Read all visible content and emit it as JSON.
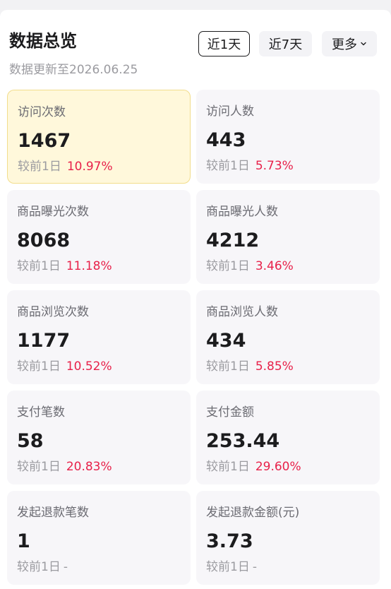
{
  "header": {
    "title": "数据总览",
    "subtitle": "数据更新至2026.06.25"
  },
  "range_tabs": [
    {
      "label": "近1天",
      "active": true
    },
    {
      "label": "近7天",
      "active": false
    }
  ],
  "more_label": "更多",
  "compare_label": "较前1日",
  "metrics": [
    {
      "label": "访问次数",
      "value": "1467",
      "change": "10.97%"
    },
    {
      "label": "访问人数",
      "value": "443",
      "change": "5.73%"
    },
    {
      "label": "商品曝光次数",
      "value": "8068",
      "change": "11.18%"
    },
    {
      "label": "商品曝光人数",
      "value": "4212",
      "change": "3.46%"
    },
    {
      "label": "商品浏览次数",
      "value": "1177",
      "change": "10.52%"
    },
    {
      "label": "商品浏览人数",
      "value": "434",
      "change": "5.85%"
    },
    {
      "label": "支付笔数",
      "value": "58",
      "change": "20.83%"
    },
    {
      "label": "支付金额",
      "value": "253.44",
      "change": "29.60%"
    },
    {
      "label": "发起退款笔数",
      "value": "1",
      "change": "-"
    },
    {
      "label": "发起退款金额(元)",
      "value": "3.73",
      "change": "-"
    }
  ],
  "colors": {
    "increase": "#e8214a",
    "highlight_bg": "#fff8db",
    "highlight_border": "#f2dd8c"
  }
}
